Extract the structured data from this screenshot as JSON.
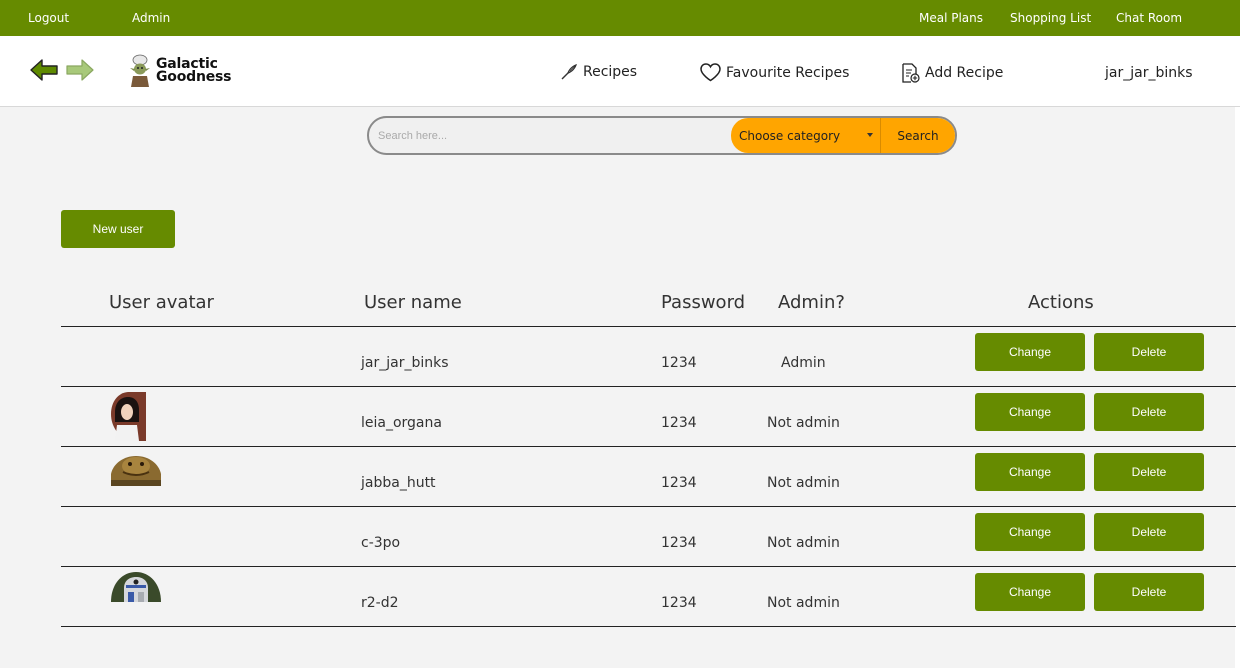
{
  "topbar": {
    "logout": "Logout",
    "admin": "Admin",
    "meal_plans": "Meal Plans",
    "shopping_list": "Shopping List",
    "chat_room": "Chat Room"
  },
  "header": {
    "logo_line1": "Galactic",
    "logo_line2": "Goodness",
    "recipes": "Recipes",
    "favourite_recipes": "Favourite Recipes",
    "add_recipe": "Add Recipe",
    "username": "jar_jar_binks"
  },
  "search": {
    "placeholder": "Search here...",
    "category": "Choose category",
    "button": "Search"
  },
  "new_user_label": "New user",
  "table": {
    "headers": {
      "avatar": "User avatar",
      "username": "User name",
      "password": "Password",
      "admin": "Admin?",
      "actions": "Actions"
    },
    "rows": [
      {
        "username": "jar_jar_binks",
        "password": "1234",
        "admin": "Admin",
        "change": "Change",
        "delete": "Delete"
      },
      {
        "username": "leia_organa",
        "password": "1234",
        "admin": "Not admin",
        "change": "Change",
        "delete": "Delete"
      },
      {
        "username": "jabba_hutt",
        "password": "1234",
        "admin": "Not admin",
        "change": "Change",
        "delete": "Delete"
      },
      {
        "username": "c-3po",
        "password": "1234",
        "admin": "Not admin",
        "change": "Change",
        "delete": "Delete"
      },
      {
        "username": "r2-d2",
        "password": "1234",
        "admin": "Not admin",
        "change": "Change",
        "delete": "Delete"
      }
    ]
  },
  "colors": {
    "accent_green": "#668b00",
    "search_orange": "#ffa500"
  }
}
